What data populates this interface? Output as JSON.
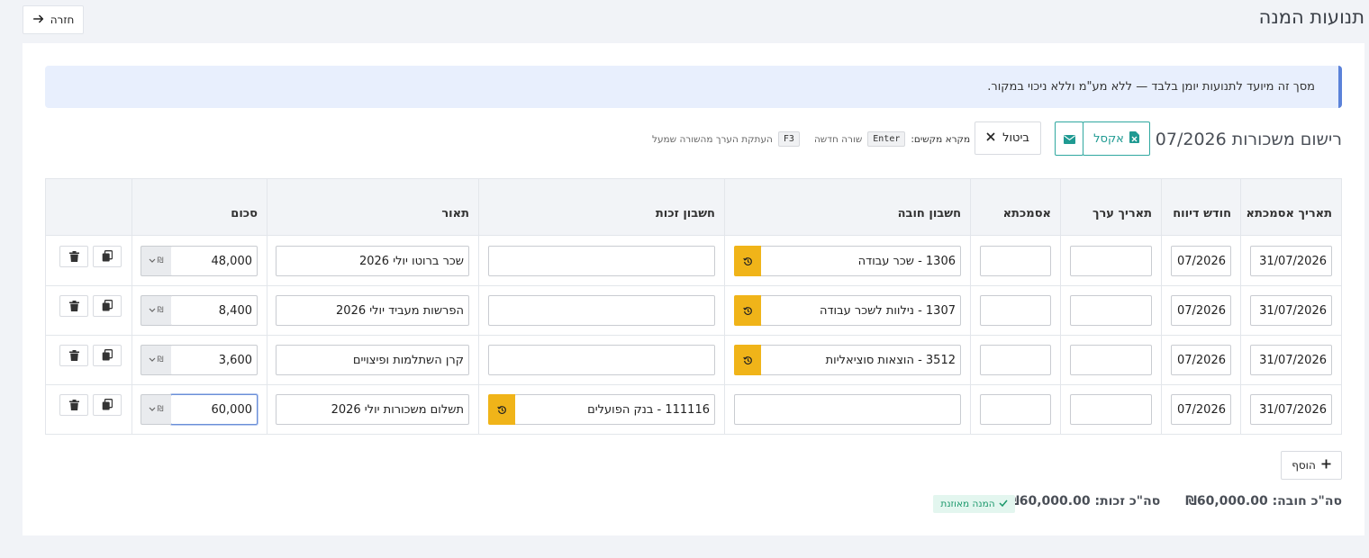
{
  "header": {
    "title": "תנועות המנה",
    "back_label": "חזרה"
  },
  "alert": {
    "text": "מסך זה מיועד לתנועות יומן בלבד — ללא מע\"מ וללא ניכוי במקור."
  },
  "toolbar": {
    "title": "רישום משכורות 07/2026",
    "excel_label": "אקסל",
    "cancel_label": "ביטול",
    "shortcuts_label": "מקרא מקשים:",
    "shortcut_new_key": "Enter",
    "shortcut_new_label": "שורה חדשה",
    "shortcut_copy_key": "F3",
    "shortcut_copy_label": "העתקת הערך מהשורה שמעל"
  },
  "table": {
    "headers": {
      "doc_date": "תאריך אסמכתא",
      "period": "חודש דיווח",
      "value_date": "תאריך ערך",
      "reference": "אסמכתא",
      "debit": "חשבון חובה",
      "credit": "חשבון זכות",
      "description": "תאור",
      "amount": "סכום"
    },
    "rows": [
      {
        "doc_date": "31/07/2026",
        "period": "07/2026",
        "value_date": "",
        "reference": "",
        "debit": "1306 - שכר עבודה",
        "credit": "",
        "description": "שכר ברוטו יולי 2026",
        "amount": "48,000",
        "currency": "₪"
      },
      {
        "doc_date": "31/07/2026",
        "period": "07/2026",
        "value_date": "",
        "reference": "",
        "debit": "1307 - נילוות לשכר עבודה",
        "credit": "",
        "description": "הפרשות מעביד יולי 2026",
        "amount": "8,400",
        "currency": "₪"
      },
      {
        "doc_date": "31/07/2026",
        "period": "07/2026",
        "value_date": "",
        "reference": "",
        "debit": "3512 - הוצאות סוציאליות",
        "credit": "",
        "description": "קרן השתלמות ופיצויים",
        "amount": "3,600",
        "currency": "₪"
      },
      {
        "doc_date": "31/07/2026",
        "period": "07/2026",
        "value_date": "",
        "reference": "",
        "debit": "",
        "credit": "111116 - בנק הפועלים",
        "description": "תשלום משכורות יולי 2026",
        "amount": "60,000",
        "currency": "₪"
      }
    ]
  },
  "footer": {
    "add_label": "הוסף",
    "total_debit_label": "סה\"כ חובה:",
    "total_debit_value": "₪60,000.00",
    "total_credit_label": "סה\"כ זכות:",
    "total_credit_value": "₪60,000.00",
    "balanced_label": "המנה מאוזנת"
  },
  "colors": {
    "accent_teal": "#30a8a0",
    "lookup_yellow": "#f0b419",
    "alert_bg": "#e8effd",
    "balanced_green": "#19976a"
  }
}
